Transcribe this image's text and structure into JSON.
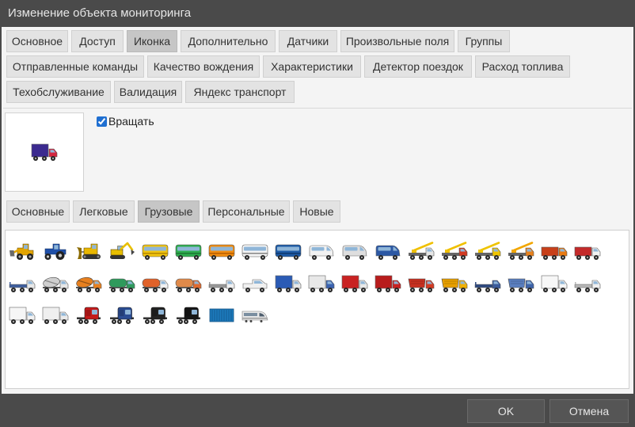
{
  "window": {
    "title": "Изменение объекта мониторинга"
  },
  "theme": {
    "chrome": "#4a4a4a",
    "body": "#f4f4f4",
    "tab": "#e3e3e3",
    "tab-active": "#c6c6c6",
    "accent": "#1f6fd1"
  },
  "tabs": {
    "rows": [
      [
        {
          "label": "Основное"
        },
        {
          "label": "Доступ"
        },
        {
          "label": "Иконка",
          "active": true
        },
        {
          "label": "Дополнительно"
        },
        {
          "label": "Датчики"
        },
        {
          "label": "Произвольные поля"
        },
        {
          "label": "Группы"
        }
      ],
      [
        {
          "label": "Отправленные команды"
        },
        {
          "label": "Качество вождения"
        },
        {
          "label": "Характеристики"
        },
        {
          "label": "Детектор поездок"
        },
        {
          "label": "Расход топлива"
        }
      ],
      [
        {
          "label": "Техобслуживание"
        },
        {
          "label": "Валидация"
        },
        {
          "label": "Яндекс транспорт"
        }
      ]
    ]
  },
  "icon_settings": {
    "preview": {
      "icon": "box-truck-icon",
      "color": "#d3263f",
      "accent": "#3b2a8f"
    },
    "rotate": {
      "label": "Вращать",
      "checked": true
    }
  },
  "icon_categories": [
    {
      "label": "Основные"
    },
    {
      "label": "Легковые"
    },
    {
      "label": "Грузовые",
      "active": true
    },
    {
      "label": "Персональные"
    },
    {
      "label": "Новые"
    }
  ],
  "vehicles": [
    {
      "icon": "wheel-loader-icon",
      "color": "#e2a400",
      "accent": "#6b6b6b"
    },
    {
      "icon": "tractor-icon",
      "color": "#1f4fa8",
      "accent": "#1f4fa8"
    },
    {
      "icon": "bulldozer-icon",
      "color": "#e9b700",
      "accent": "#8a6a00"
    },
    {
      "icon": "excavator-icon",
      "color": "#e8bf00",
      "accent": "#e8bf00"
    },
    {
      "icon": "bus-icon",
      "color": "#f1c40f",
      "accent": "#b88a00"
    },
    {
      "icon": "bus-icon",
      "color": "#2eae4f",
      "accent": "#1d7a34"
    },
    {
      "icon": "bus-icon",
      "color": "#f28c0f",
      "accent": "#b85f00"
    },
    {
      "icon": "bus-icon",
      "color": "#f4f4f4",
      "accent": "#8a8a8a"
    },
    {
      "icon": "bus-icon",
      "color": "#1d5aa6",
      "accent": "#0f3a70"
    },
    {
      "icon": "van-icon",
      "color": "#f2f2f2",
      "accent": "#f2f2f2"
    },
    {
      "icon": "van-icon",
      "color": "#dedede",
      "accent": "#dedede"
    },
    {
      "icon": "van-icon",
      "color": "#2c58a4",
      "accent": "#2c58a4"
    },
    {
      "icon": "crane-truck-icon",
      "color": "#e6e6e6",
      "accent": "#f0c000"
    },
    {
      "icon": "crane-truck-icon",
      "color": "#d23a22",
      "accent": "#f0c000"
    },
    {
      "icon": "crane-truck-icon",
      "color": "#efc400",
      "accent": "#efc400"
    },
    {
      "icon": "crane-truck-icon",
      "color": "#e8821e",
      "accent": "#f2a600"
    },
    {
      "icon": "truck-icon",
      "color": "#e97a12",
      "accent": "#c8401a"
    },
    {
      "icon": "truck-icon",
      "color": "#f2f2f2",
      "accent": "#c42a2a"
    },
    {
      "icon": "flatbed-truck-icon",
      "color": "#e8e8e8",
      "accent": "#3f5f9f"
    },
    {
      "icon": "cement-mixer-icon",
      "color": "#e6e6e6",
      "accent": "#cfcfcf"
    },
    {
      "icon": "cement-mixer-icon",
      "color": "#e7801f",
      "accent": "#e7801f"
    },
    {
      "icon": "tanker-truck-icon",
      "color": "#2f9a5c",
      "accent": "#2f9a5c"
    },
    {
      "icon": "tanker-truck-icon",
      "color": "#f0f0f0",
      "accent": "#e0622a"
    },
    {
      "icon": "tanker-truck-icon",
      "color": "#e06a2e",
      "accent": "#e08a4a"
    },
    {
      "icon": "flatbed-truck-icon",
      "color": "#f0f0f0",
      "accent": "#9a9a9a"
    },
    {
      "icon": "pickup-icon",
      "color": "#f0f0f0",
      "accent": "#f0f0f0"
    },
    {
      "icon": "box-truck-icon",
      "color": "#e8e8e8",
      "accent": "#2b5bb5"
    },
    {
      "icon": "box-truck-icon",
      "color": "#3a62b0",
      "accent": "#e8e8e8"
    },
    {
      "icon": "box-truck-icon",
      "color": "#e8e8e8",
      "accent": "#c92222"
    },
    {
      "icon": "box-truck-icon",
      "color": "#c92222",
      "accent": "#b81c1c"
    },
    {
      "icon": "dump-truck-icon",
      "color": "#d33a22",
      "accent": "#c83020"
    },
    {
      "icon": "dump-truck-icon",
      "color": "#f0b000",
      "accent": "#e8a000"
    },
    {
      "icon": "flatbed-truck-icon",
      "color": "#3b5b9b",
      "accent": "#2e4a80"
    },
    {
      "icon": "dump-truck-icon",
      "color": "#3e63a9",
      "accent": "#5a7fc0"
    },
    {
      "icon": "box-truck-icon",
      "color": "#f4f4f4",
      "accent": "#f7f7f7"
    },
    {
      "icon": "flatbed-truck-icon",
      "color": "#f0f0f0",
      "accent": "#b8b8b8"
    },
    {
      "icon": "box-truck-icon",
      "color": "#f2f2f2",
      "accent": "#f6f6f6"
    },
    {
      "icon": "box-truck-icon",
      "color": "#eaeaea",
      "accent": "#efefef"
    },
    {
      "icon": "semi-truck-icon",
      "color": "#c41a1a",
      "accent": "#c41a1a"
    },
    {
      "icon": "semi-truck-icon",
      "color": "#2b4c92",
      "accent": "#2b4c92"
    },
    {
      "icon": "semi-truck-icon",
      "color": "#222222",
      "accent": "#222222"
    },
    {
      "icon": "semi-truck-icon",
      "color": "#161616",
      "accent": "#161616"
    },
    {
      "icon": "container-icon",
      "color": "#1d7bbd",
      "accent": "#0f4f80"
    },
    {
      "icon": "train-icon",
      "color": "#e8e8e8",
      "accent": "#7a8ea0"
    }
  ],
  "footer": {
    "ok_label": "OK",
    "cancel_label": "Отмена"
  }
}
